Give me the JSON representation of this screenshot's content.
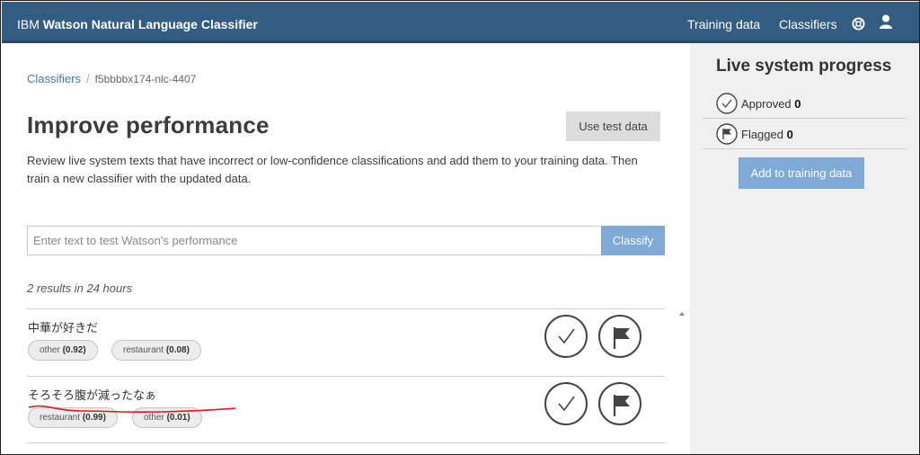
{
  "header": {
    "brand_prefix": "IBM",
    "brand_name": "Watson Natural Language Classifier",
    "nav": [
      {
        "label": "Training data"
      },
      {
        "label": "Classifiers"
      }
    ],
    "icons": [
      "help-icon",
      "user-icon"
    ],
    "color": "#325c80"
  },
  "breadcrumb": {
    "root": "Classifiers",
    "separator": "/",
    "current": "f5bbbbx174-nlc-4407"
  },
  "page": {
    "title": "Improve performance",
    "use_test_data_label": "Use test data",
    "description": "Review live system texts that have incorrect or low-confidence classifications and add them to your training data. Then train a new classifier with the updated data."
  },
  "search": {
    "placeholder": "Enter text to test Watson's performance",
    "value": "",
    "classify_label": "Classify"
  },
  "results": {
    "summary": "2 results in 24 hours",
    "items": [
      {
        "text": "中華が好きだ",
        "classes": [
          {
            "name": "other",
            "confidence": "(0.92)"
          },
          {
            "name": "restaurant",
            "confidence": "(0.08)"
          }
        ]
      },
      {
        "text": "そろそろ腹が減ったなぁ",
        "classes": [
          {
            "name": "restaurant",
            "confidence": "(0.99)"
          },
          {
            "name": "other",
            "confidence": "(0.01)"
          }
        ]
      }
    ]
  },
  "sidebar": {
    "title": "Live system progress",
    "approved_label": "Approved",
    "approved_count": "0",
    "flagged_label": "Flagged",
    "flagged_count": "0",
    "add_button_label": "Add to training data"
  },
  "colors": {
    "accent": "#7fa9d6",
    "link": "#4178be",
    "annotation": "#e0191b"
  }
}
